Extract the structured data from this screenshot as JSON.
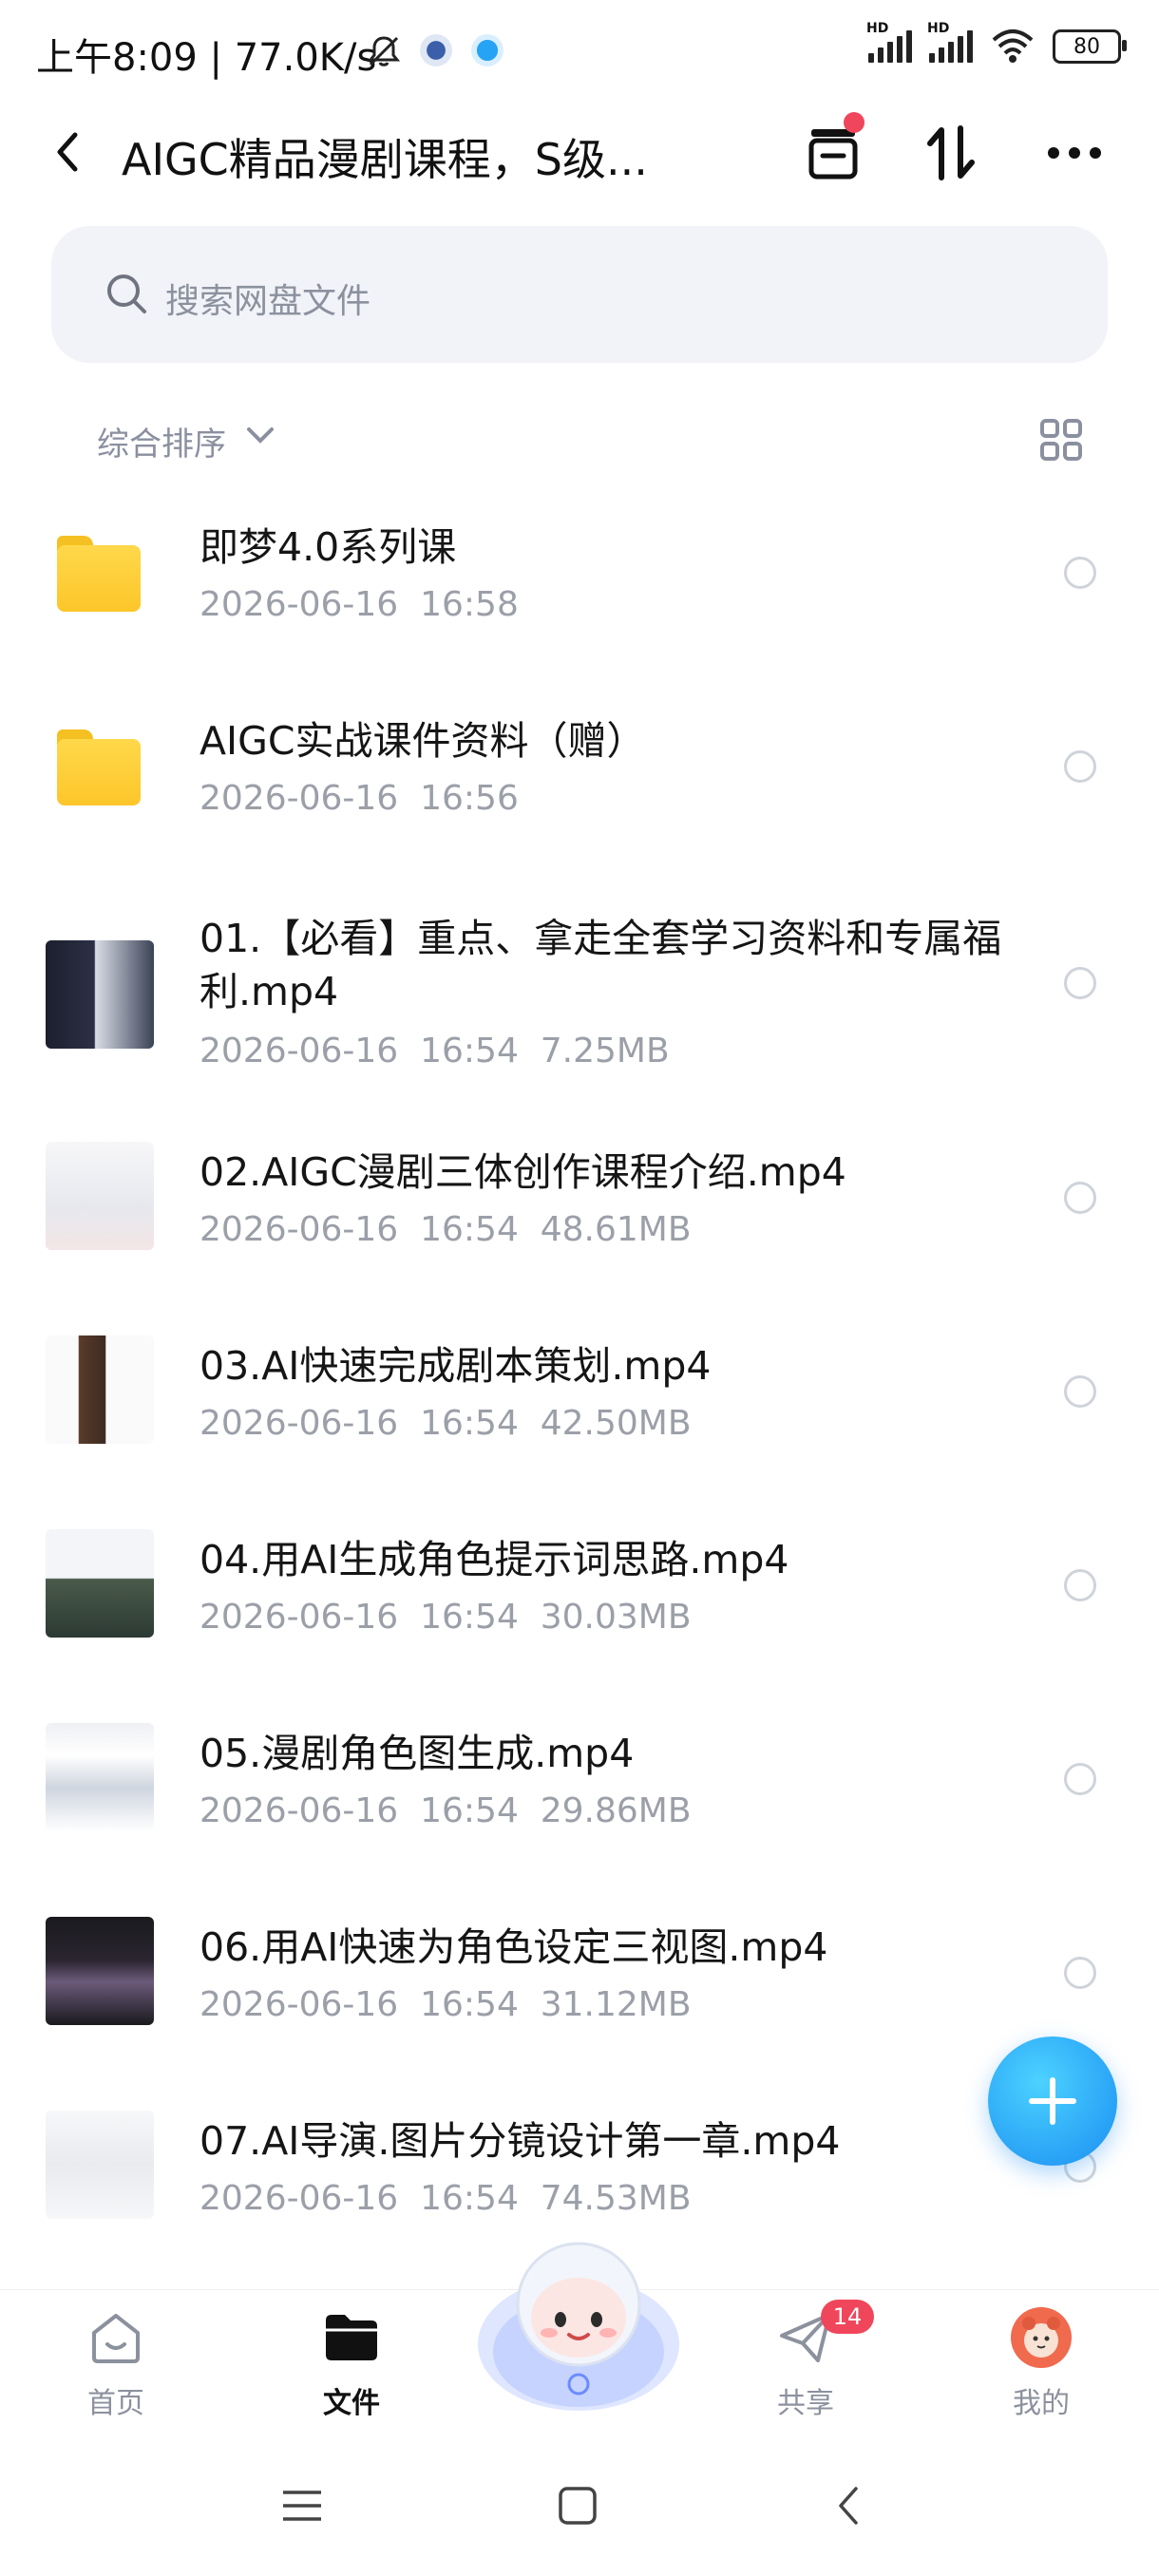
{
  "status": {
    "time_speed": "上午8:09 | 77.0K/s",
    "signal_label": "HD",
    "battery": "80"
  },
  "appbar": {
    "title": "AIGC精品漫剧课程，S级..."
  },
  "search": {
    "placeholder": "搜索网盘文件"
  },
  "sort": {
    "label": "综合排序"
  },
  "files": [
    {
      "name": "即梦4.0系列课",
      "date": "2026-06-16  16:58",
      "size": "",
      "kind": "folder"
    },
    {
      "name": "AIGC实战课件资料（赠）",
      "date": "2026-06-16  16:56",
      "size": "",
      "kind": "folder"
    },
    {
      "name": "01.【必看】重点、拿走全套学习资料和专属福利.mp4",
      "date": "2026-06-16  16:54",
      "size": "7.25MB",
      "kind": "video"
    },
    {
      "name": "02.AIGC漫剧三体创作课程介绍.mp4",
      "date": "2026-06-16  16:54",
      "size": "48.61MB",
      "kind": "video"
    },
    {
      "name": "03.AI快速完成剧本策划.mp4",
      "date": "2026-06-16  16:54",
      "size": "42.50MB",
      "kind": "video"
    },
    {
      "name": "04.用AI生成角色提示词思路.mp4",
      "date": "2026-06-16  16:54",
      "size": "30.03MB",
      "kind": "video"
    },
    {
      "name": "05.漫剧角色图生成.mp4",
      "date": "2026-06-16  16:54",
      "size": "29.86MB",
      "kind": "video"
    },
    {
      "name": "06.用AI快速为角色设定三视图.mp4",
      "date": "2026-06-16  16:54",
      "size": "31.12MB",
      "kind": "video"
    },
    {
      "name": "07.AI导演.图片分镜设计第一章.mp4",
      "date": "2026-06-16  16:54",
      "size": "74.53MB",
      "kind": "video"
    }
  ],
  "tabbar": {
    "home": "首页",
    "files": "文件",
    "share": "共享",
    "share_badge": "14",
    "me": "我的"
  },
  "colors": {
    "accent": "#1a8ef2",
    "badge": "#f0465b",
    "folder": "#fcc62a"
  }
}
